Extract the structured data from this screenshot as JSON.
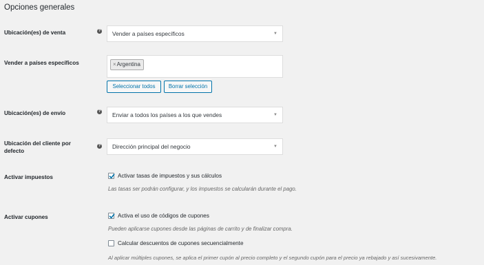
{
  "page_title": "Opciones generales",
  "colors": {
    "accent": "#0073aa",
    "background": "#f1f1f1"
  },
  "help_icon": "?",
  "fields": {
    "selling_location": {
      "label": "Ubicación(es) de venta",
      "value": "Vender a países específicos",
      "caret": "▼"
    },
    "specific_countries": {
      "label": "Vender a países específicos",
      "chips": [
        {
          "remove": "×",
          "label": "Argentina"
        }
      ],
      "select_all": "Seleccionar todos",
      "clear_selection": "Borrar selección"
    },
    "shipping_location": {
      "label": "Ubicación(es) de envío",
      "value": "Enviar a todos los países a los que vendes",
      "caret": "▼"
    },
    "default_customer_location": {
      "label_line1": "Ubicación del cliente por",
      "label_line2": "defecto",
      "value": "Dirección principal del negocio",
      "caret": "▼"
    },
    "enable_taxes": {
      "label": "Activar impuestos",
      "checkbox_label": "Activar tasas de impuestos y sus cálculos",
      "checked": true,
      "description": "Las tasas ser podrán configurar, y los impuestos se calcularán durante el pago."
    },
    "enable_coupons": {
      "label": "Activar cupones",
      "checkbox_label": "Activa el uso de códigos de cupones",
      "checked": true,
      "description": "Pueden aplicarse cupones desde las páginas de carrito y de finalizar compra.",
      "sequential_label": "Calcular descuentos de cupones secuencialmente",
      "sequential_checked": false,
      "sequential_description": "Al aplicar múltiples cupones, se aplica el primer cupón al precio completo y el segundo cupón para el precio ya rebajado y así sucesivamente."
    }
  }
}
